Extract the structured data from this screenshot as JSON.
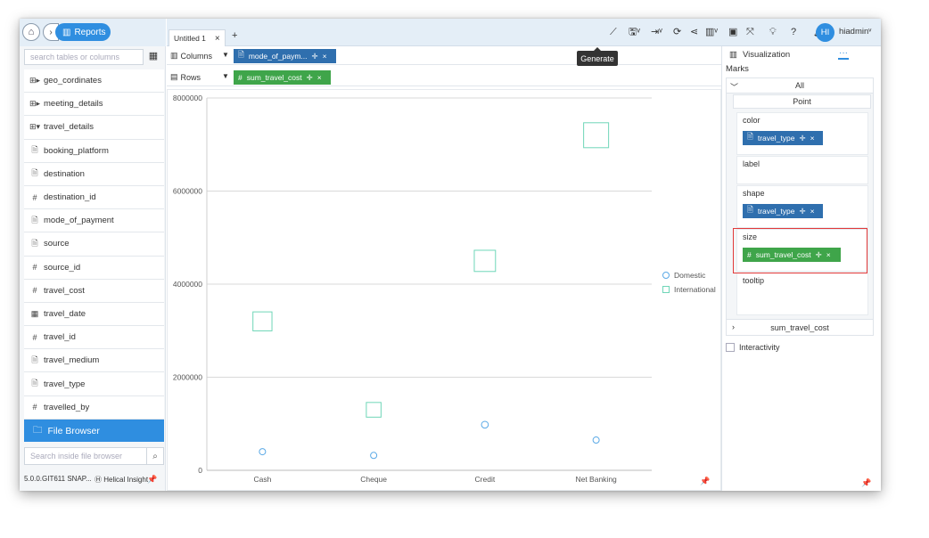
{
  "nav": {
    "reports_label": "Reports"
  },
  "left_panel": {
    "search_placeholder": "search tables or columns",
    "fields": [
      {
        "icon": "table-icon",
        "glyph": "⊞▸",
        "label": "geo_cordinates"
      },
      {
        "icon": "table-icon",
        "glyph": "⊞▸",
        "label": "meeting_details"
      },
      {
        "icon": "table-icon",
        "glyph": "⊞▾",
        "label": "travel_details"
      },
      {
        "icon": "text-field-icon",
        "glyph": "🗎",
        "label": "booking_platform"
      },
      {
        "icon": "text-field-icon",
        "glyph": "🗎",
        "label": "destination"
      },
      {
        "icon": "number-field-icon",
        "glyph": "#",
        "label": "destination_id"
      },
      {
        "icon": "text-field-icon",
        "glyph": "🗎",
        "label": "mode_of_payment"
      },
      {
        "icon": "text-field-icon",
        "glyph": "🗎",
        "label": "source"
      },
      {
        "icon": "number-field-icon",
        "glyph": "#",
        "label": "source_id"
      },
      {
        "icon": "number-field-icon",
        "glyph": "#",
        "label": "travel_cost"
      },
      {
        "icon": "date-field-icon",
        "glyph": "▦",
        "label": "travel_date"
      },
      {
        "icon": "number-field-icon",
        "glyph": "#",
        "label": "travel_id"
      },
      {
        "icon": "text-field-icon",
        "glyph": "🗎",
        "label": "travel_medium"
      },
      {
        "icon": "text-field-icon",
        "glyph": "🗎",
        "label": "travel_type"
      },
      {
        "icon": "number-field-icon",
        "glyph": "#",
        "label": "travelled_by"
      }
    ],
    "file_browser_label": "File Browser",
    "file_search_placeholder": "Search inside file browser",
    "version": "5.0.0.GIT611 SNAP...",
    "brand": "Helical Insight"
  },
  "top_bar": {
    "tab_label": "Untitled 1",
    "tooltip": "Generate",
    "avatar_initials": "HI",
    "username": "hiadmin"
  },
  "shelves": {
    "columns_label": "Columns",
    "columns_pill": "mode_of_paym...",
    "rows_label": "Rows",
    "rows_pill": "sum_travel_cost"
  },
  "right_panel": {
    "viz_tab": "Visualization",
    "more_tab": "···",
    "marks_title": "Marks",
    "all_label": "All",
    "point_label": "Point",
    "color_title": "color",
    "color_pill": "travel_type",
    "label_title": "label",
    "shape_title": "shape",
    "shape_pill": "travel_type",
    "size_title": "size",
    "size_pill": "sum_travel_cost",
    "tooltip_title": "tooltip",
    "sum_row_label": "sum_travel_cost",
    "interactivity_label": "Interactivity"
  },
  "colors": {
    "domestic": "#5aa9e6",
    "international": "#6fd6b8",
    "accent": "#2f8ee0",
    "pill_blue": "#2f6fae",
    "pill_green": "#3fa54a",
    "highlight": "#e23a3a"
  },
  "chart_data": {
    "type": "scatter",
    "categories": [
      "Cash",
      "Cheque",
      "Credit",
      "Net Banking"
    ],
    "yticks": [
      "0",
      "2000000",
      "4000000",
      "6000000",
      "8000000"
    ],
    "ylim": [
      0,
      8000000
    ],
    "grid": true,
    "legend_placement": "right",
    "series": [
      {
        "name": "Domestic",
        "shape": "circle",
        "values": [
          400000,
          320000,
          980000,
          650000
        ]
      },
      {
        "name": "International",
        "shape": "square",
        "values": [
          3200000,
          1300000,
          4500000,
          7200000
        ]
      }
    ]
  }
}
